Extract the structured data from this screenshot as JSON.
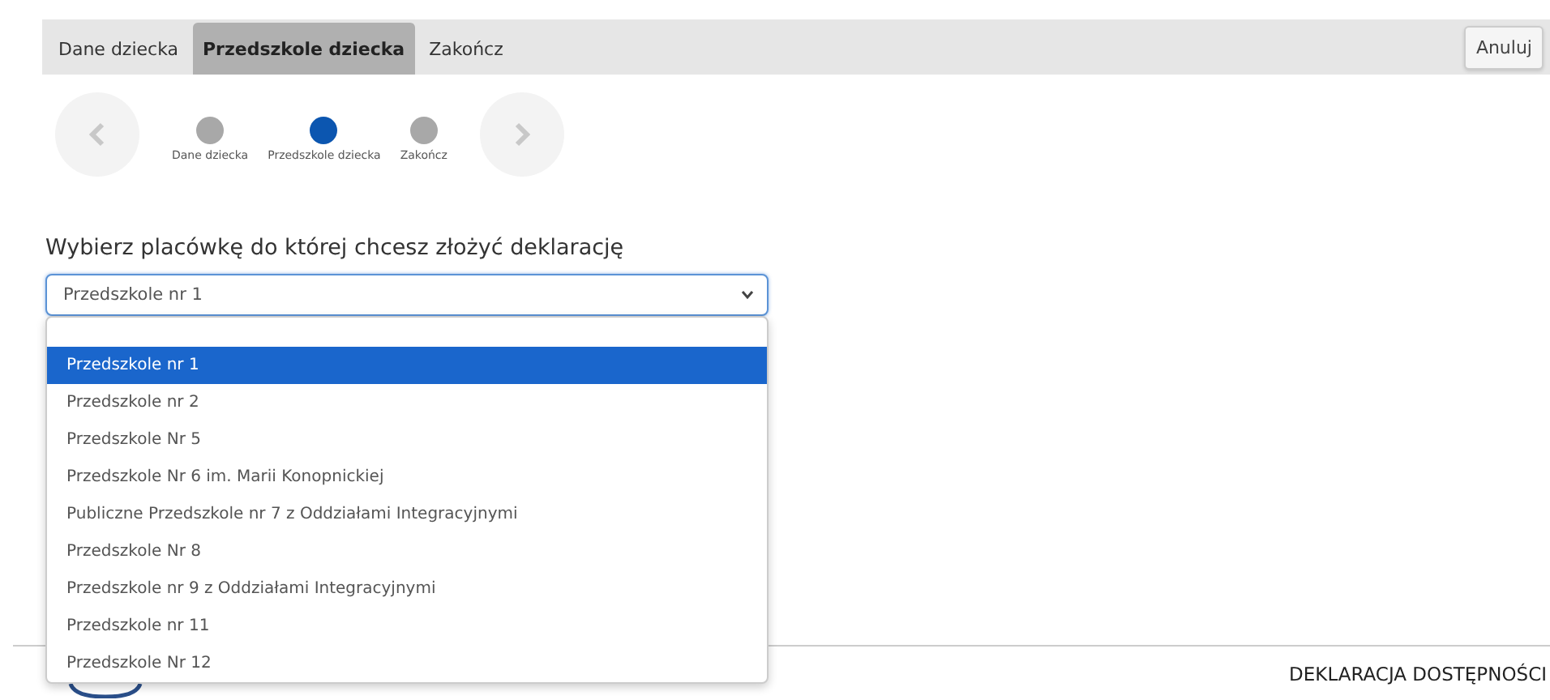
{
  "tabs": [
    {
      "label": "Dane dziecka",
      "selected": false
    },
    {
      "label": "Przedszkole dziecka",
      "selected": true
    },
    {
      "label": "Zakończ",
      "selected": false
    }
  ],
  "cancel_button": "Anuluj",
  "stepper": {
    "steps": [
      {
        "label": "Dane dziecka",
        "selected": false
      },
      {
        "label": "Przedszkole dziecka",
        "selected": true
      },
      {
        "label": "Zakończ",
        "selected": false
      }
    ]
  },
  "heading": "Wybierz placówkę do której chcesz złożyć deklarację",
  "select": {
    "value": "Przedszkole nr 1",
    "expanded": true,
    "options": [
      {
        "label": "Przedszkole nr 1",
        "selected": true
      },
      {
        "label": "Przedszkole nr 2",
        "selected": false
      },
      {
        "label": "Przedszkole Nr 5",
        "selected": false
      },
      {
        "label": "Przedszkole Nr 6 im. Marii Konopnickiej",
        "selected": false
      },
      {
        "label": "Publiczne Przedszkole nr 7 z Oddziałami Integracyjnymi",
        "selected": false
      },
      {
        "label": "Przedszkole Nr 8",
        "selected": false
      },
      {
        "label": "Przedszkole nr 9 z Oddziałami Integracyjnymi",
        "selected": false
      },
      {
        "label": "Przedszkole nr 11",
        "selected": false
      },
      {
        "label": "Przedszkole Nr 12",
        "selected": false
      }
    ]
  },
  "footer": {
    "link": "DEKLARACJA DOSTĘPNOŚCI"
  }
}
